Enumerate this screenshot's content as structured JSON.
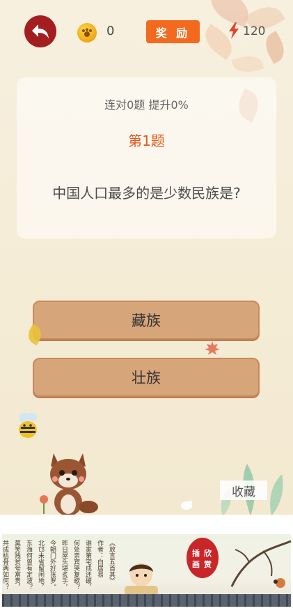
{
  "top_bar": {
    "coin_count": "0",
    "reward_label": "奖 励",
    "energy_count": "120"
  },
  "question": {
    "streak_text": "连对0题 提升0%",
    "number_label": "第1题",
    "text": "中国人口最多的是少数民族是?"
  },
  "answers": [
    "藏族",
    "壮族"
  ],
  "favorite_label": "收藏",
  "banner": {
    "poem_title": "《放言五首其》",
    "poem_author": "作者：白居易",
    "poem_lines": [
      "谁家第宅成还破，",
      "何处亲宾哭复歌？",
      "昨日屋头堪炙手，",
      "今朝门外好张罗。",
      "北邙未省留闲地，",
      "东海何曾有定波？",
      "莫笑贱贫夸富贵，",
      "共成枯骨两如何？"
    ],
    "seal_text": [
      "插",
      "画",
      "欣",
      "赏"
    ]
  },
  "colors": {
    "back_button": "#a31f1f",
    "reward_button": "#f36a1f",
    "question_number": "#e35a1e",
    "answer_button": "#d7a57a"
  },
  "icons": [
    "back-arrow-icon",
    "coin-icon",
    "lightning-icon",
    "bee-icon",
    "fox-icon"
  ]
}
